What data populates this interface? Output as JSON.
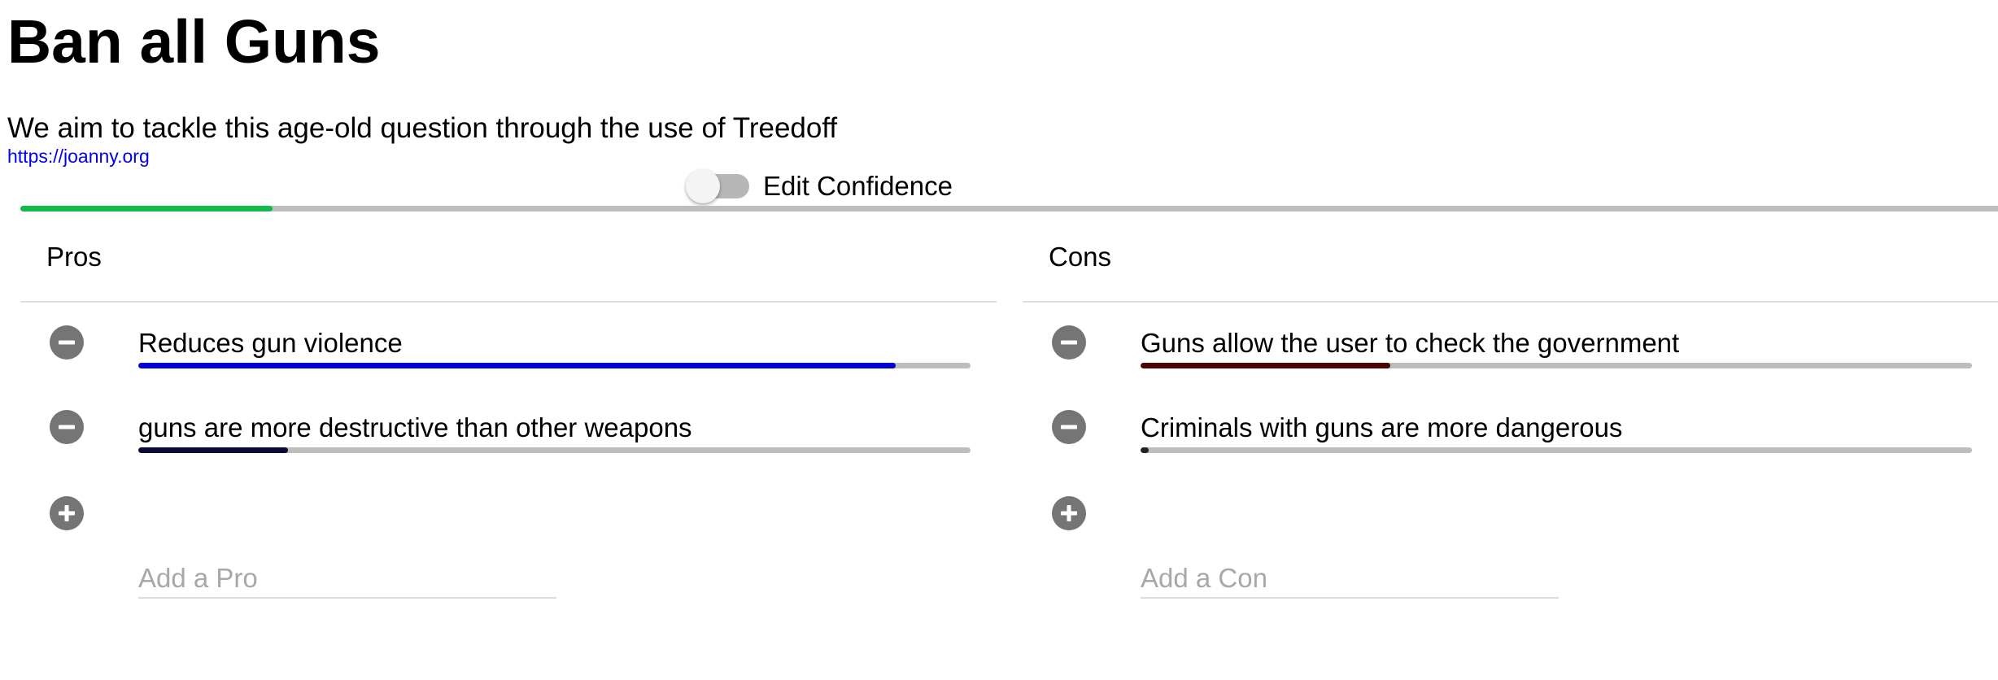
{
  "page": {
    "title": "Ban all Guns",
    "subtitle": "We aim to tackle this age-old question through the use of Treedoff",
    "link": "https://joanny.org"
  },
  "toggle": {
    "label": "Edit Confidence",
    "checked": false
  },
  "overall_confidence": {
    "value": 0.1276,
    "color": "#13b94a"
  },
  "pros": {
    "header": "Pros",
    "items": [
      {
        "text": "Reduces gun violence",
        "confidence": 0.91,
        "color": "#0000d6",
        "icon": "minus-circle-icon"
      },
      {
        "text": "guns are more destructive than other weapons",
        "confidence": 0.18,
        "color": "#0a0a33",
        "icon": "minus-circle-icon"
      }
    ],
    "add_icon": "plus-circle-icon",
    "add_placeholder": "Add a Pro"
  },
  "cons": {
    "header": "Cons",
    "items": [
      {
        "text": "Guns allow the user to check the government",
        "confidence": 0.3,
        "color": "#4a0505",
        "icon": "minus-circle-icon"
      },
      {
        "text": "Criminals with guns are more dangerous",
        "confidence": 0.01,
        "color": "#222222",
        "icon": "minus-circle-icon"
      }
    ],
    "add_icon": "plus-circle-icon",
    "add_placeholder": "Add a Con"
  }
}
